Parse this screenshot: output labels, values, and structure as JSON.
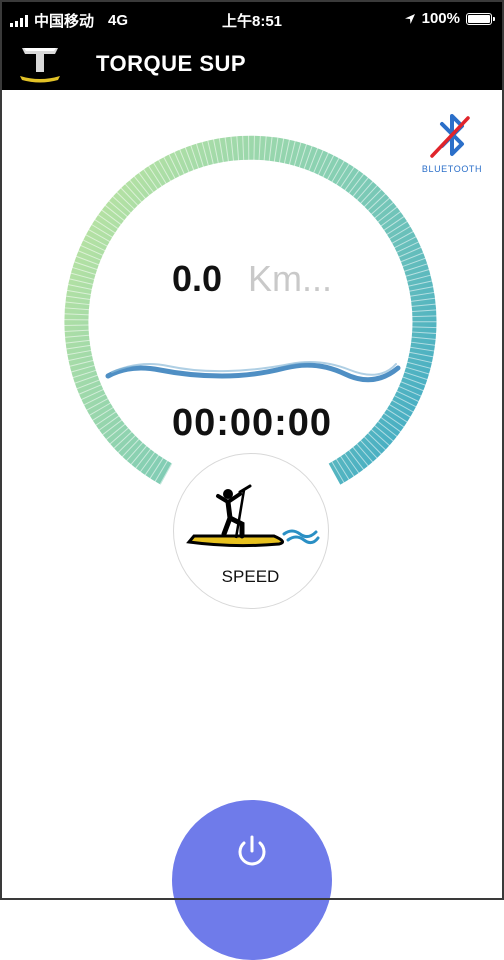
{
  "status_bar": {
    "carrier": "中国移动",
    "network": "4G",
    "time": "上午8:51",
    "battery": "100%"
  },
  "header": {
    "title": "TORQUE SUP",
    "logo_icon": "torque-t-logo-icon"
  },
  "bluetooth": {
    "label": "BLUETOOTH",
    "state": "disconnected",
    "icon": "bluetooth-off-icon"
  },
  "gauge": {
    "speed": "0.0",
    "unit": "Km...",
    "duration": "00:00:00",
    "gradient": [
      "#b9e3a1",
      "#86cfb3",
      "#47aec4"
    ]
  },
  "mode": {
    "label": "SPEED",
    "icon": "paddle-board-rider-icon"
  },
  "power": {
    "icon": "power-icon",
    "color": "#6f7bea"
  }
}
